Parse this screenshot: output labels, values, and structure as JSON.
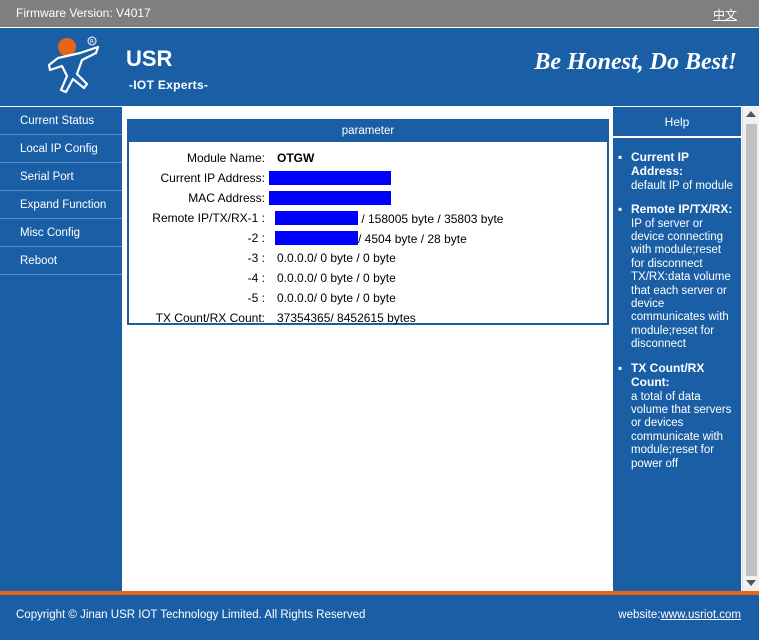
{
  "topbar": {
    "firmware_label": "Firmware Version:  V4017",
    "lang_link": "中文"
  },
  "header": {
    "brand": "USR",
    "brand_sub": "-IOT Experts-",
    "slogan": "Be Honest, Do Best!",
    "colors": {
      "blue": "#1a5fa6",
      "orange": "#e8641b"
    }
  },
  "sidebar": {
    "items": [
      {
        "label": "Current Status"
      },
      {
        "label": "Local IP Config"
      },
      {
        "label": "Serial Port"
      },
      {
        "label": "Expand Function"
      },
      {
        "label": "Misc Config"
      },
      {
        "label": "Reboot"
      }
    ]
  },
  "panel": {
    "title": "parameter",
    "rows": [
      {
        "label": "Module Name:",
        "value": "OTGW"
      },
      {
        "label": "Current IP Address:",
        "value": ""
      },
      {
        "label": "MAC Address:",
        "value": ""
      },
      {
        "label": "Remote IP/TX/RX-1 :",
        "value": " / 158005 byte / 35803 byte"
      },
      {
        "label": "-2 :",
        "value": "/ 4504 byte / 28 byte"
      },
      {
        "label": "-3 :",
        "value": "0.0.0.0/ 0 byte / 0 byte"
      },
      {
        "label": "-4 :",
        "value": "0.0.0.0/ 0 byte / 0 byte"
      },
      {
        "label": "-5 :",
        "value": "0.0.0.0/ 0 byte / 0 byte"
      },
      {
        "label": "TX Count/RX Count:",
        "value": "37354365/ 8452615 bytes"
      }
    ]
  },
  "help": {
    "title": "Help",
    "items": [
      {
        "term": "Current IP Address:",
        "desc": "default IP of module"
      },
      {
        "term": "Remote IP/TX/RX:",
        "desc": "IP of server or device connecting with module;reset for disconnect TX/RX:data volume that each server or device communicates with module;reset for disconnect"
      },
      {
        "term": "TX Count/RX Count:",
        "desc": "a total of data volume that servers or devices communicate with module;reset for power off"
      }
    ]
  },
  "footer": {
    "copyright": "Copyright © Jinan USR IOT Technology Limited. All Rights Reserved",
    "website_label": "website:",
    "website_link": "www.usriot.com"
  }
}
